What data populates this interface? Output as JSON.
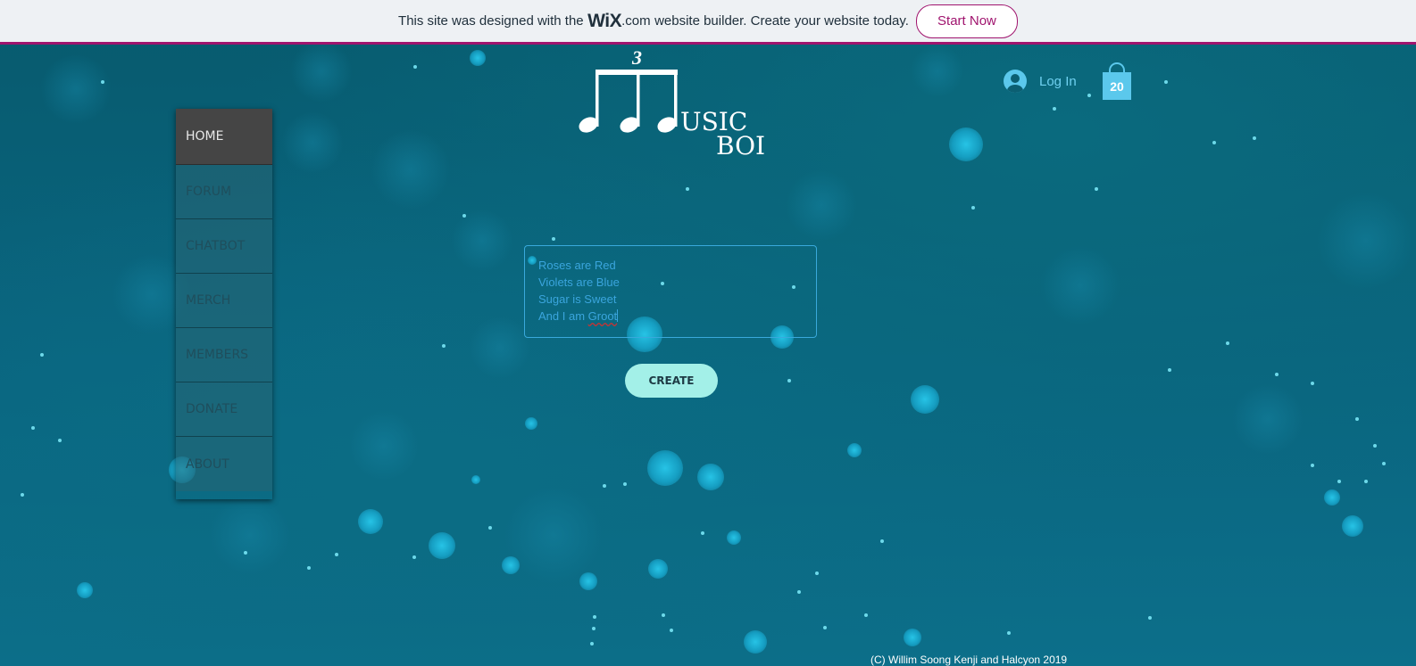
{
  "wix_banner": {
    "text_before": "This site was designed with the",
    "logo": "WiX",
    "logo_suffix": ".com",
    "text_after": "website builder. Create your website today.",
    "cta_label": "Start Now",
    "accent_color": "#a0146e"
  },
  "logo": {
    "triplet_mark": "3",
    "line1": "USIC",
    "line2": "BOI"
  },
  "header": {
    "login_label": "Log In",
    "login_icon": "user-avatar-icon",
    "cart_icon": "shopping-bag-icon",
    "cart_count": "20"
  },
  "nav": {
    "items": [
      {
        "label": "HOME",
        "active": true
      },
      {
        "label": "FORUM",
        "active": false
      },
      {
        "label": "CHATBOT",
        "active": false
      },
      {
        "label": "MERCH",
        "active": false
      },
      {
        "label": "MEMBERS",
        "active": false
      },
      {
        "label": "DONATE",
        "active": false
      },
      {
        "label": "ABOUT",
        "active": false
      }
    ]
  },
  "editor": {
    "lines": [
      "Roses are Red",
      "Violets are Blue",
      "Sugar is Sweet",
      "And I am"
    ],
    "misspelled_word": "Groot"
  },
  "create_button": {
    "label": "CREATE"
  },
  "footer": {
    "text": "(C) Willim Soong Kenji and Halcyon 2019"
  },
  "colors": {
    "background": "#0b5f72",
    "link": "#6fd0f0",
    "button": "#a3f0e8",
    "input_border": "#39a9dc"
  }
}
